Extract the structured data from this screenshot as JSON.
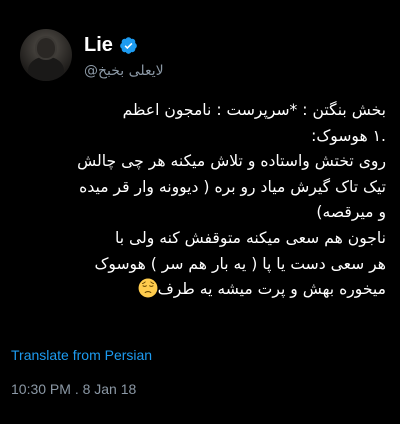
{
  "author": {
    "display_name": "Lie",
    "handle": "@لایعلی بخبخ",
    "verified": true,
    "avatar_icon": "profile-photo-person-hood"
  },
  "tweet": {
    "lines": [
      "بخش بنگتن : *سرپرست : نامجون اعظم",
      ".١ هوسوک:",
      "روی تختش واستاده و تلاش میکنه هر چی چالش",
      "تیک تاک گیرش میاد رو بره ( دیوونه وار قر میده",
      "و میرقصه)",
      "ناجون هم سعی میکنه متوقفش کنه ولی با",
      "هر سعی دست یا پا ( یه بار هم سر ) هوسوک",
      "میخوره بهش و پرت میشه یه طرف"
    ],
    "end_emoji": "pensive-face-emoji"
  },
  "translate_link": "Translate from Persian",
  "timestamp": "10:30 PM . 8 Jan 18",
  "colors": {
    "background": "#000000",
    "text": "#ffffff",
    "secondary": "#8b98a5",
    "accent": "#1d9bf0"
  }
}
